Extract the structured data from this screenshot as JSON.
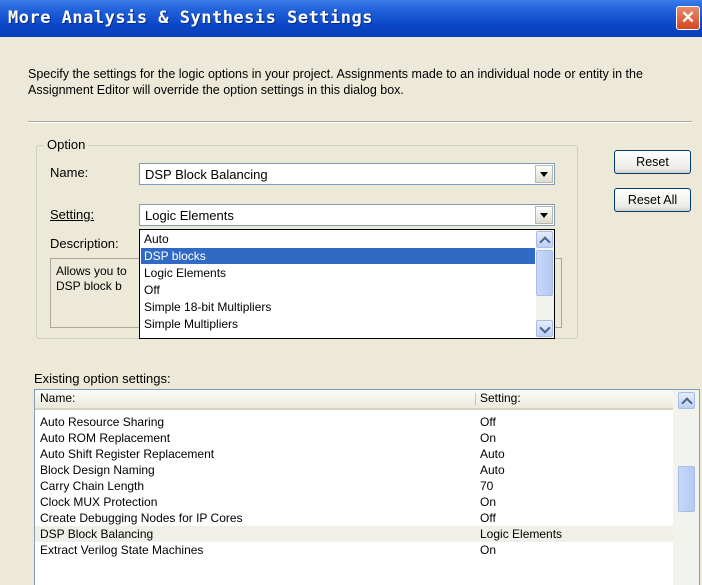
{
  "window": {
    "title": "More Analysis & Synthesis Settings",
    "close_glyph": "✕"
  },
  "intro_text": "Specify the settings for the logic options in your project.  Assignments made to an individual node or entity in the Assignment Editor will override the option settings in this dialog box.",
  "option_group": {
    "label": "Option",
    "name_label": "Name:",
    "name_value": "DSP Block Balancing",
    "setting_label": "Setting:",
    "setting_value": "Logic Elements",
    "description_label": "Description:",
    "description_lines": [
      "Allows you to",
      "DSP block b"
    ]
  },
  "setting_dropdown": {
    "options": [
      "Auto",
      "DSP blocks",
      "Logic Elements",
      "Off",
      "Simple 18-bit Multipliers",
      "Simple Multipliers"
    ],
    "highlighted": "DSP blocks"
  },
  "buttons": {
    "reset": "Reset",
    "reset_all": "Reset All"
  },
  "existing": {
    "label": "Existing option settings:",
    "columns": [
      "Name:",
      "Setting:"
    ],
    "rows": [
      [
        "Auto Resource Sharing",
        "Off"
      ],
      [
        "Auto ROM Replacement",
        "On"
      ],
      [
        "Auto Shift Register Replacement",
        "Auto"
      ],
      [
        "Block Design Naming",
        "Auto"
      ],
      [
        "Carry Chain Length",
        "70"
      ],
      [
        "Clock MUX Protection",
        "On"
      ],
      [
        "Create Debugging Nodes for IP Cores",
        "Off"
      ],
      [
        "DSP Block Balancing",
        "Logic Elements"
      ],
      [
        "Extract Verilog State Machines",
        "On"
      ]
    ],
    "highlighted_row": "DSP Block Balancing"
  },
  "colors": {
    "titlebar": "#0a46c8",
    "selection": "#316ac5",
    "dialog_bg": "#ece9d8"
  }
}
